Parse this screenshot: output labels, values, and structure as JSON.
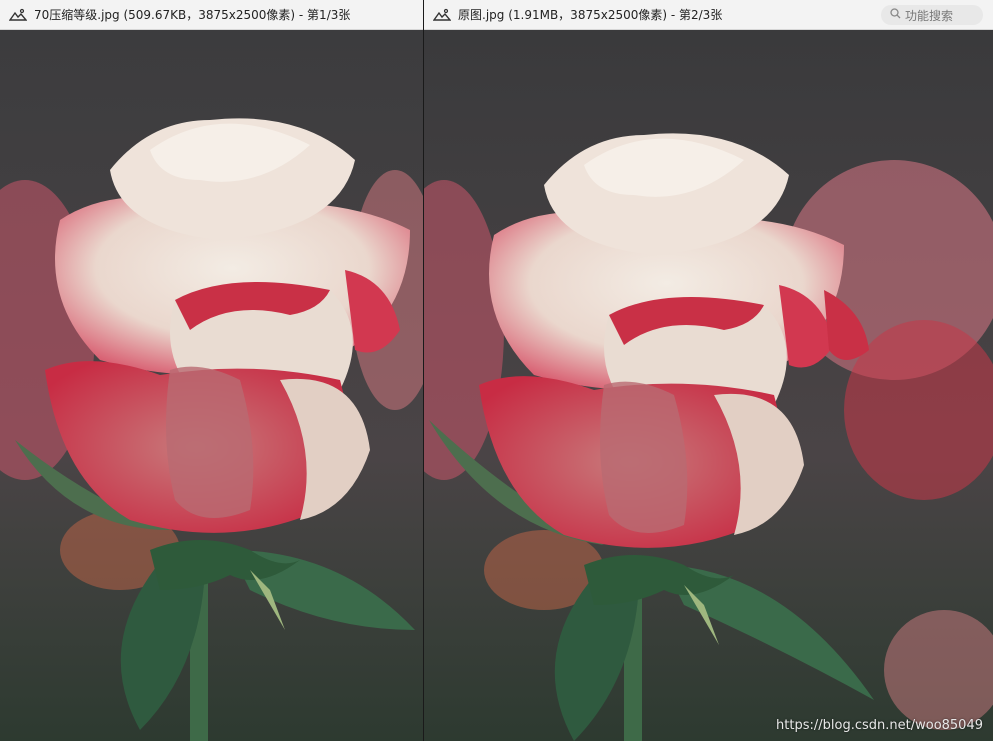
{
  "left_pane": {
    "title": "70压缩等级.jpg (509.67KB，3875x2500像素) - 第1/3张",
    "icon": "image-icon"
  },
  "right_pane": {
    "title": "原图.jpg (1.91MB，3875x2500像素) - 第2/3张",
    "icon": "image-icon",
    "search_placeholder": "功能搜索"
  },
  "watermark": "https://blog.csdn.net/woo85049",
  "colors": {
    "background": "#2e2e30",
    "petal_pink": "#d8425a",
    "petal_cream": "#f1e6dc",
    "leaf_green": "#2f5a3f"
  }
}
